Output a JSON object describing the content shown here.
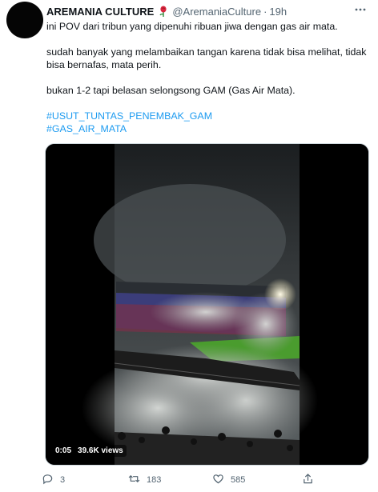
{
  "tweet": {
    "author_name": "AREMANIA CULTURE",
    "author_handle": "@AremaniaCulture",
    "separator": "·",
    "timestamp": "19h",
    "lines": {
      "l1": "ini POV dari tribun yang dipenuhi ribuan jiwa dengan gas air mata.",
      "l2": "sudah banyak yang melambaikan tangan karena tidak bisa melihat, tidak",
      "l3": "bisa bernafas, mata perih.",
      "l4": "bukan 1-2 tapi belasan selongsong GAM (Gas Air Mata)."
    },
    "hashtags": [
      "#USUT_TUNTAS_PENEMBAK_GAM",
      "#GAS_AIR_MATA"
    ],
    "more_icon": "more-icon",
    "emoji_icon": "rose-icon"
  },
  "video": {
    "elapsed": "0:05",
    "views": "39.6K views"
  },
  "actions": {
    "reply_count": "3",
    "retweet_count": "183",
    "like_count": "585",
    "icons": [
      "reply-icon",
      "retweet-icon",
      "like-icon",
      "share-icon"
    ]
  },
  "colors": {
    "link": "#1d9bf0",
    "secondary": "#536471",
    "text": "#0f1419",
    "pitch": "#4a9c2e"
  }
}
